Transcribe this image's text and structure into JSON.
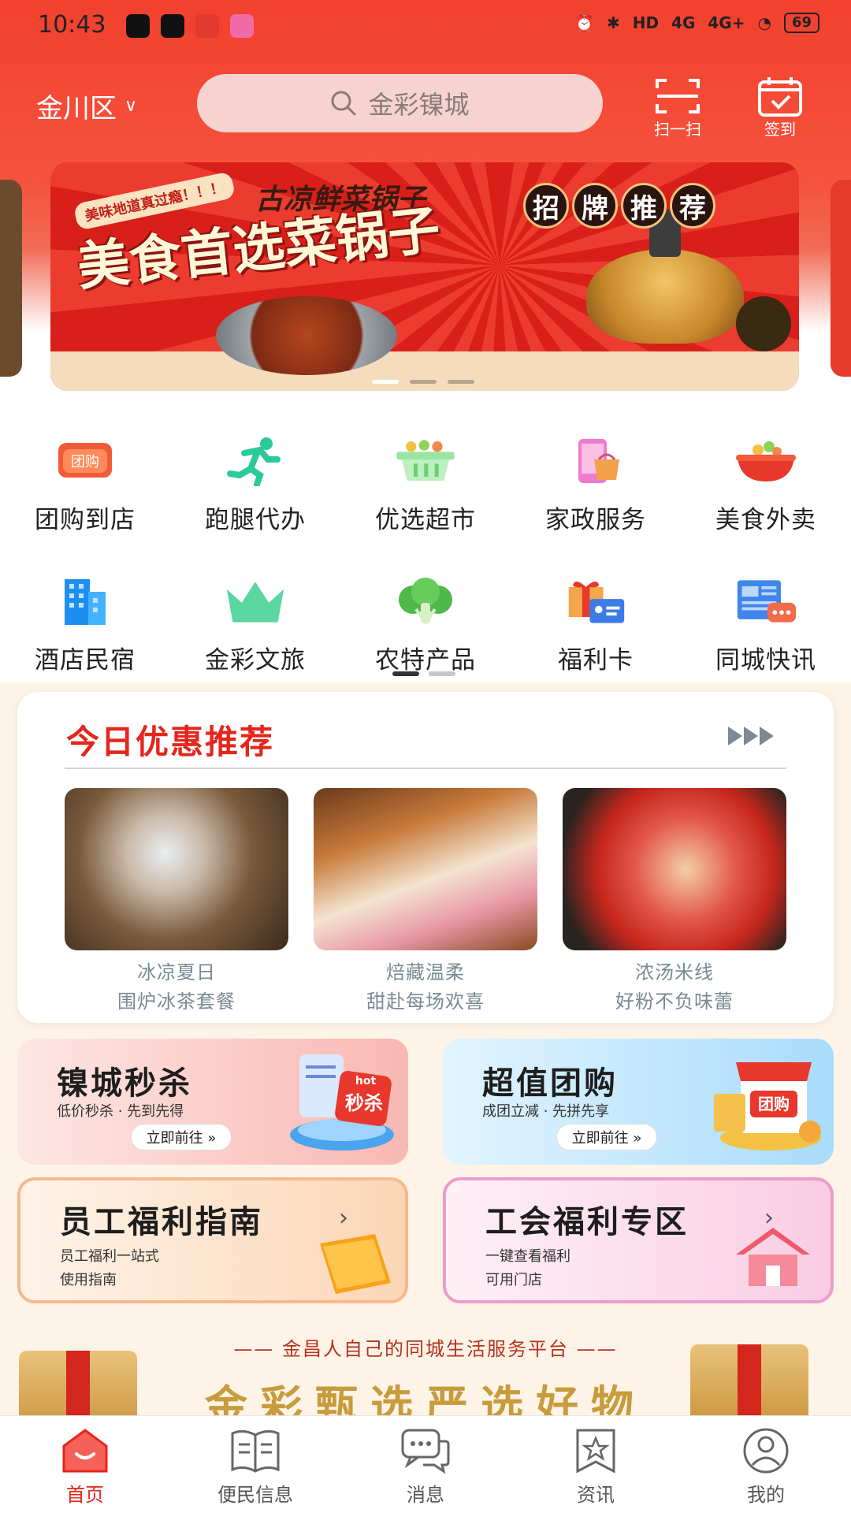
{
  "status_bar": {
    "time": "10:43",
    "network": [
      "HD",
      "4G",
      "4G+"
    ],
    "battery": "69"
  },
  "header": {
    "location": "金川区",
    "search_placeholder": "金彩镍城",
    "scan_label": "扫一扫",
    "checkin_label": "签到",
    "accent_color": "#f2402e"
  },
  "banner": {
    "tagline": "美味地道真过瘾！！！",
    "brand": "古凉鲜菜锅子",
    "headline": "美食首选菜锅子",
    "stamp": [
      "招",
      "牌",
      "推",
      "荐"
    ],
    "page_count": 3,
    "active_page": 1
  },
  "categories": [
    {
      "label": "团购到店",
      "icon": "group-buy-icon"
    },
    {
      "label": "跑腿代办",
      "icon": "runner-icon"
    },
    {
      "label": "优选超市",
      "icon": "basket-icon"
    },
    {
      "label": "家政服务",
      "icon": "home-service-icon"
    },
    {
      "label": "美食外卖",
      "icon": "food-bowl-icon"
    },
    {
      "label": "酒店民宿",
      "icon": "hotel-icon"
    },
    {
      "label": "金彩文旅",
      "icon": "crown-icon"
    },
    {
      "label": "农特产品",
      "icon": "vegetable-icon"
    },
    {
      "label": "福利卡",
      "icon": "gift-card-icon"
    },
    {
      "label": "同城快讯",
      "icon": "news-icon"
    }
  ],
  "today": {
    "title": "今日优惠推荐",
    "cards": [
      {
        "line1": "冰凉夏日",
        "line2": "围炉冰茶套餐"
      },
      {
        "line1": "焙藏温柔",
        "line2": "甜赴每场欢喜"
      },
      {
        "line1": "浓汤米线",
        "line2": "好粉不负味蕾"
      }
    ]
  },
  "promos": {
    "seckill": {
      "title": "镍城秒杀",
      "sub": "低价秒杀 · 先到先得",
      "button": "立即前往 »",
      "badge_top": "hot",
      "badge": "秒杀"
    },
    "groupbuy": {
      "title": "超值团购",
      "sub": "成团立减 · 先拼先享",
      "button": "立即前往 »",
      "badge": "团购"
    },
    "welfare_guide": {
      "title": "员工福利指南",
      "sub1": "员工福利一站式",
      "sub2": "使用指南"
    },
    "union_zone": {
      "title": "工会福利专区",
      "sub1": "一键查看福利",
      "sub2": "可用门店"
    }
  },
  "footer_banner": {
    "slogan": "—— 金昌人自己的同城生活服务平台 ——",
    "big": "金彩甄选严选好物"
  },
  "tabbar": [
    {
      "label": "首页",
      "icon": "home-icon"
    },
    {
      "label": "便民信息",
      "icon": "book-icon"
    },
    {
      "label": "消息",
      "icon": "message-icon"
    },
    {
      "label": "资讯",
      "icon": "bookmark-star-icon"
    },
    {
      "label": "我的",
      "icon": "user-icon"
    }
  ]
}
